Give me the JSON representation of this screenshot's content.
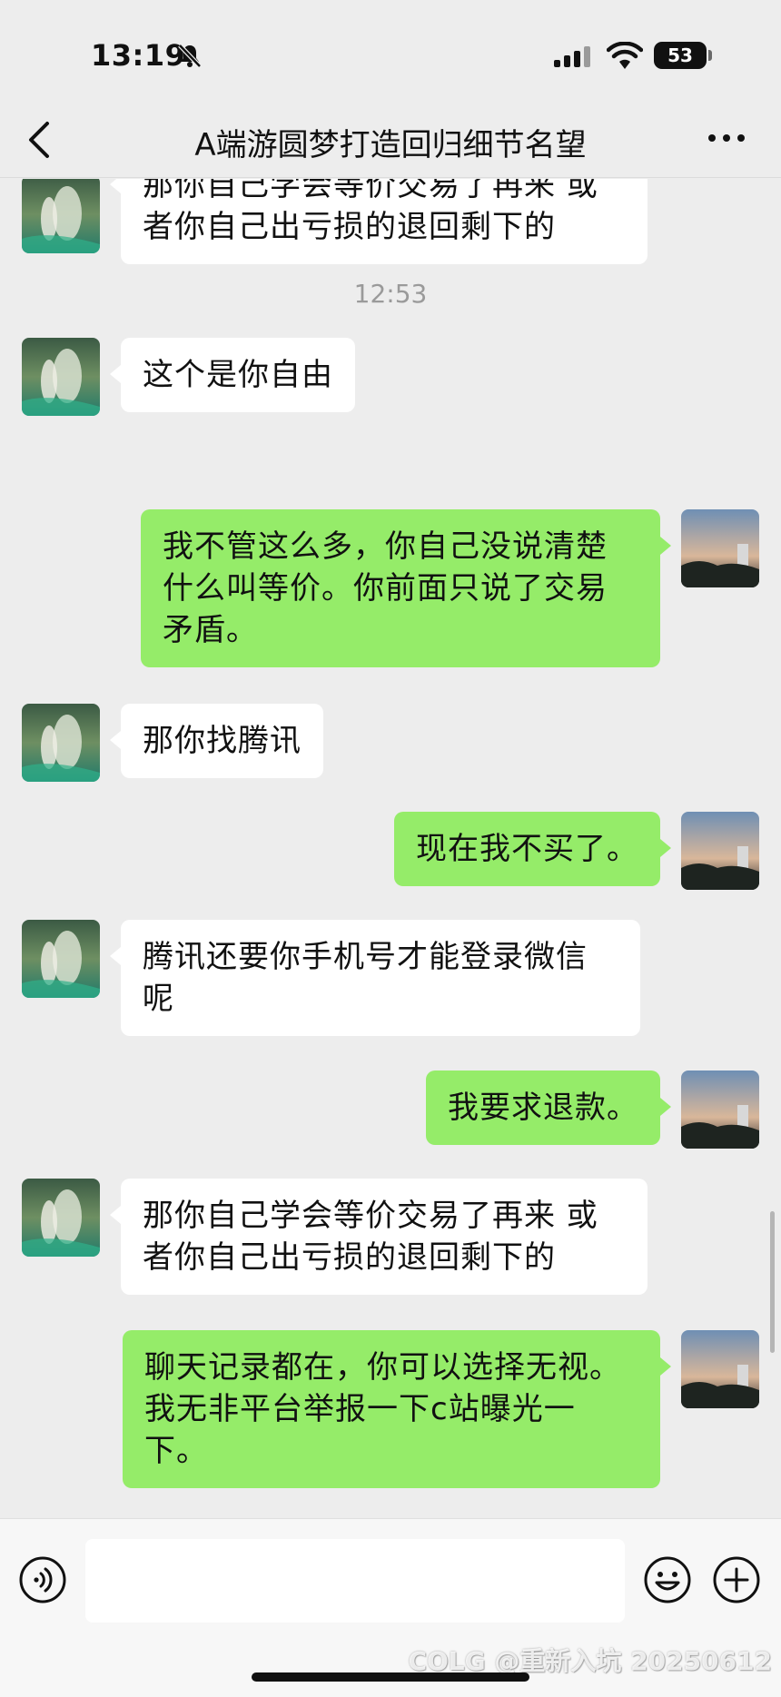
{
  "status_bar": {
    "time": "13:19",
    "battery": "53"
  },
  "nav": {
    "title": "A端游圆梦打造回归细节名望"
  },
  "chat": {
    "messages": [
      {
        "side": "left",
        "text": "那你自己学会等价交易了再来 或者你自己出亏损的退回剩下的"
      },
      {
        "type": "time",
        "text": "12:53"
      },
      {
        "side": "left",
        "text": "这个是你自由"
      },
      {
        "side": "right",
        "text": "我不管这么多，你自己没说清楚什么叫等价。你前面只说了交易矛盾。"
      },
      {
        "side": "left",
        "text": "那你找腾讯"
      },
      {
        "side": "right",
        "text": "现在我不买了。"
      },
      {
        "side": "left",
        "text": "腾讯还要你手机号才能登录微信呢"
      },
      {
        "side": "right",
        "text": "我要求退款。"
      },
      {
        "side": "left",
        "text": "那你自己学会等价交易了再来 或者你自己出亏损的退回剩下的"
      },
      {
        "side": "right",
        "text": "聊天记录都在，你可以选择无视。我无非平台举报一下c站曝光一下。"
      }
    ]
  },
  "input": {
    "value": "",
    "placeholder": ""
  },
  "watermark": "COLG @重新入坑 20250612",
  "colors": {
    "background": "#ededed",
    "bubble_self": "#95ec69",
    "bubble_other": "#ffffff"
  }
}
